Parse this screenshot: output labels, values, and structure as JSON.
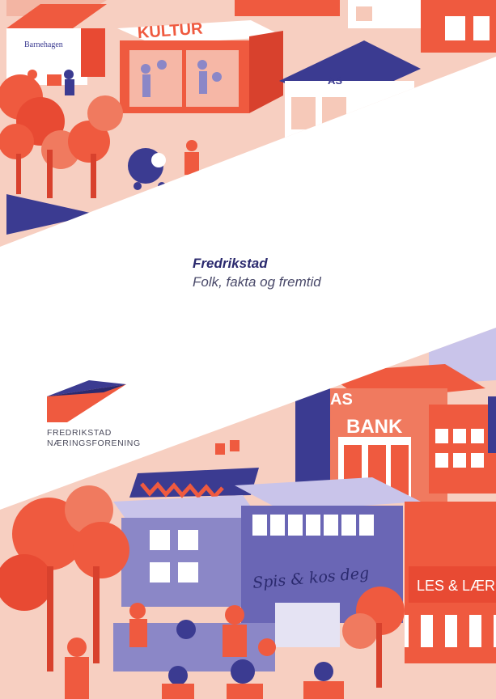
{
  "title": "Fredrikstad",
  "subtitle": "Folk, fakta og fremtid",
  "organization": {
    "line1": "FREDRIKSTAD",
    "line2": "NÆRINGSFORENING"
  },
  "illustration_signs": {
    "barnehagen": "Barnehagen",
    "kultur": "KULTUR",
    "as_top": "AS",
    "as_bottom": "AS",
    "bank": "BANK",
    "cafe": "Spis & kos deg",
    "bookstore": "LES & LÆR"
  },
  "colors": {
    "coral": "#ef5a3f",
    "navy": "#3b3b91",
    "lavender": "#8b87c7",
    "pink": "#f6c9b9",
    "title": "#2b2a6e"
  }
}
